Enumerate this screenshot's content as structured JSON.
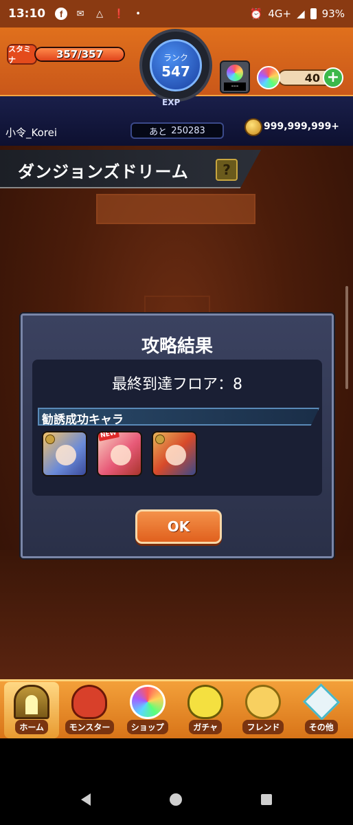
{
  "status_bar": {
    "time": "13:10",
    "network": "4G+",
    "battery": "93%"
  },
  "header": {
    "stamina_label": "スタミナ",
    "stamina_value": "357/357",
    "stamina_fraction": 1.0,
    "rank_label": "ランク",
    "rank_value": "547",
    "exp_label": "EXP",
    "exp_prefix": "あと",
    "exp_value": "250283",
    "orb_slot_text": "---",
    "orb_count": "40",
    "username": "小令_Korei",
    "gold": "999,999,999+"
  },
  "page": {
    "title": "ダンジョンズドリーム",
    "help_label": "?"
  },
  "dialog": {
    "title": "攻略結果",
    "floor_text": "最終到達フロア：8",
    "recruit_label": "勧誘成功キャラ",
    "new_badge": "NEW",
    "ok_label": "OK"
  },
  "bottom_nav": {
    "items": [
      {
        "label": "ホーム",
        "icon": "home-icon"
      },
      {
        "label": "モンスター",
        "icon": "monster-icon"
      },
      {
        "label": "ショップ",
        "icon": "shop-icon"
      },
      {
        "label": "ガチャ",
        "icon": "gacha-icon"
      },
      {
        "label": "フレンド",
        "icon": "friend-icon"
      },
      {
        "label": "その他",
        "icon": "other-icon"
      }
    ]
  },
  "colors": {
    "accent_orange": "#e0701c",
    "dialog_bg": "#2a3048",
    "ok_button": "#e0601e"
  }
}
